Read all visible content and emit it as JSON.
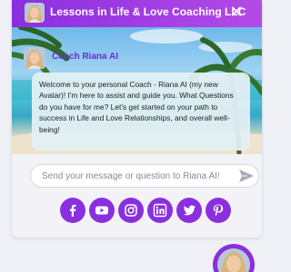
{
  "header": {
    "title": "Lessons in Life & Love Coaching LLC",
    "close_symbol": "✕",
    "background": "#8a2fe0"
  },
  "coach": {
    "name": "Coach Riana AI"
  },
  "message": {
    "text": "Welcome to your personal Coach - Riana AI (my new Avatar)! I'm here to assist and guide you. What Questions do you have for me? Let's get started on your path to success in Life and Love Relationships, and overall well-being!"
  },
  "input": {
    "placeholder": "Send your message or question to Riana AI!",
    "value": ""
  },
  "icons": {
    "close": "close-icon",
    "send": "send-icon",
    "launcher": "chat-avatar-icon"
  },
  "social": [
    {
      "name": "facebook",
      "icon": "facebook-icon"
    },
    {
      "name": "youtube",
      "icon": "youtube-icon"
    },
    {
      "name": "instagram",
      "icon": "instagram-icon"
    },
    {
      "name": "linkedin",
      "icon": "linkedin-icon"
    },
    {
      "name": "twitter",
      "icon": "twitter-icon"
    },
    {
      "name": "pinterest",
      "icon": "pinterest-icon"
    }
  ],
  "colors": {
    "accent": "#8a2fe0",
    "coach_name": "#6a2bd8",
    "bubble": "#e2f0f4"
  }
}
